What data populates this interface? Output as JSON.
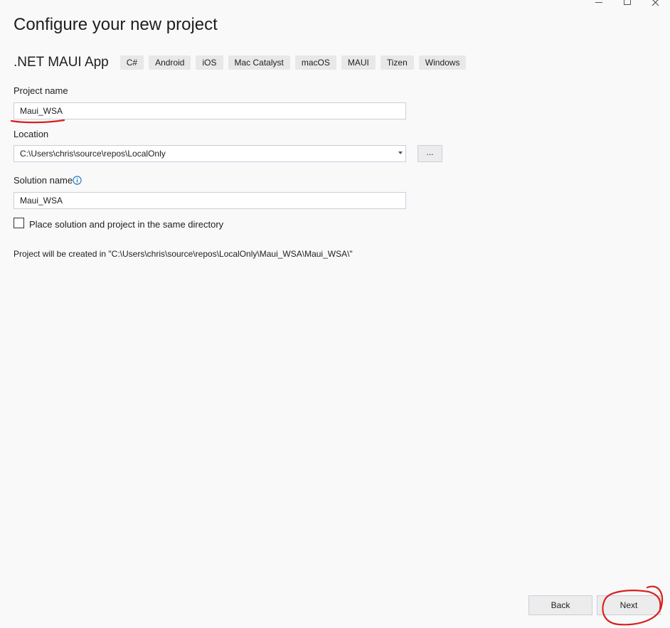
{
  "window": {
    "title": "Configure your new project"
  },
  "template": {
    "name": ".NET MAUI App",
    "tags": [
      "C#",
      "Android",
      "iOS",
      "Mac Catalyst",
      "macOS",
      "MAUI",
      "Tizen",
      "Windows"
    ]
  },
  "project_name": {
    "label": "Project name",
    "value": "Maui_WSA"
  },
  "location": {
    "label": "Location",
    "value": "C:\\Users\\chris\\source\\repos\\LocalOnly",
    "browse_label": "..."
  },
  "solution_name": {
    "label": "Solution name",
    "value": "Maui_WSA"
  },
  "same_directory": {
    "label": "Place solution and project in the same directory",
    "checked": false
  },
  "path_note": "Project will be created in \"C:\\Users\\chris\\source\\repos\\LocalOnly\\Maui_WSA\\Maui_WSA\\\"",
  "buttons": {
    "back": "Back",
    "next": "Next"
  },
  "colors": {
    "accent": "#0e70c0",
    "annotation": "#d92020"
  },
  "icons": [
    "minimize-icon",
    "maximize-icon",
    "close-icon",
    "info-icon"
  ]
}
